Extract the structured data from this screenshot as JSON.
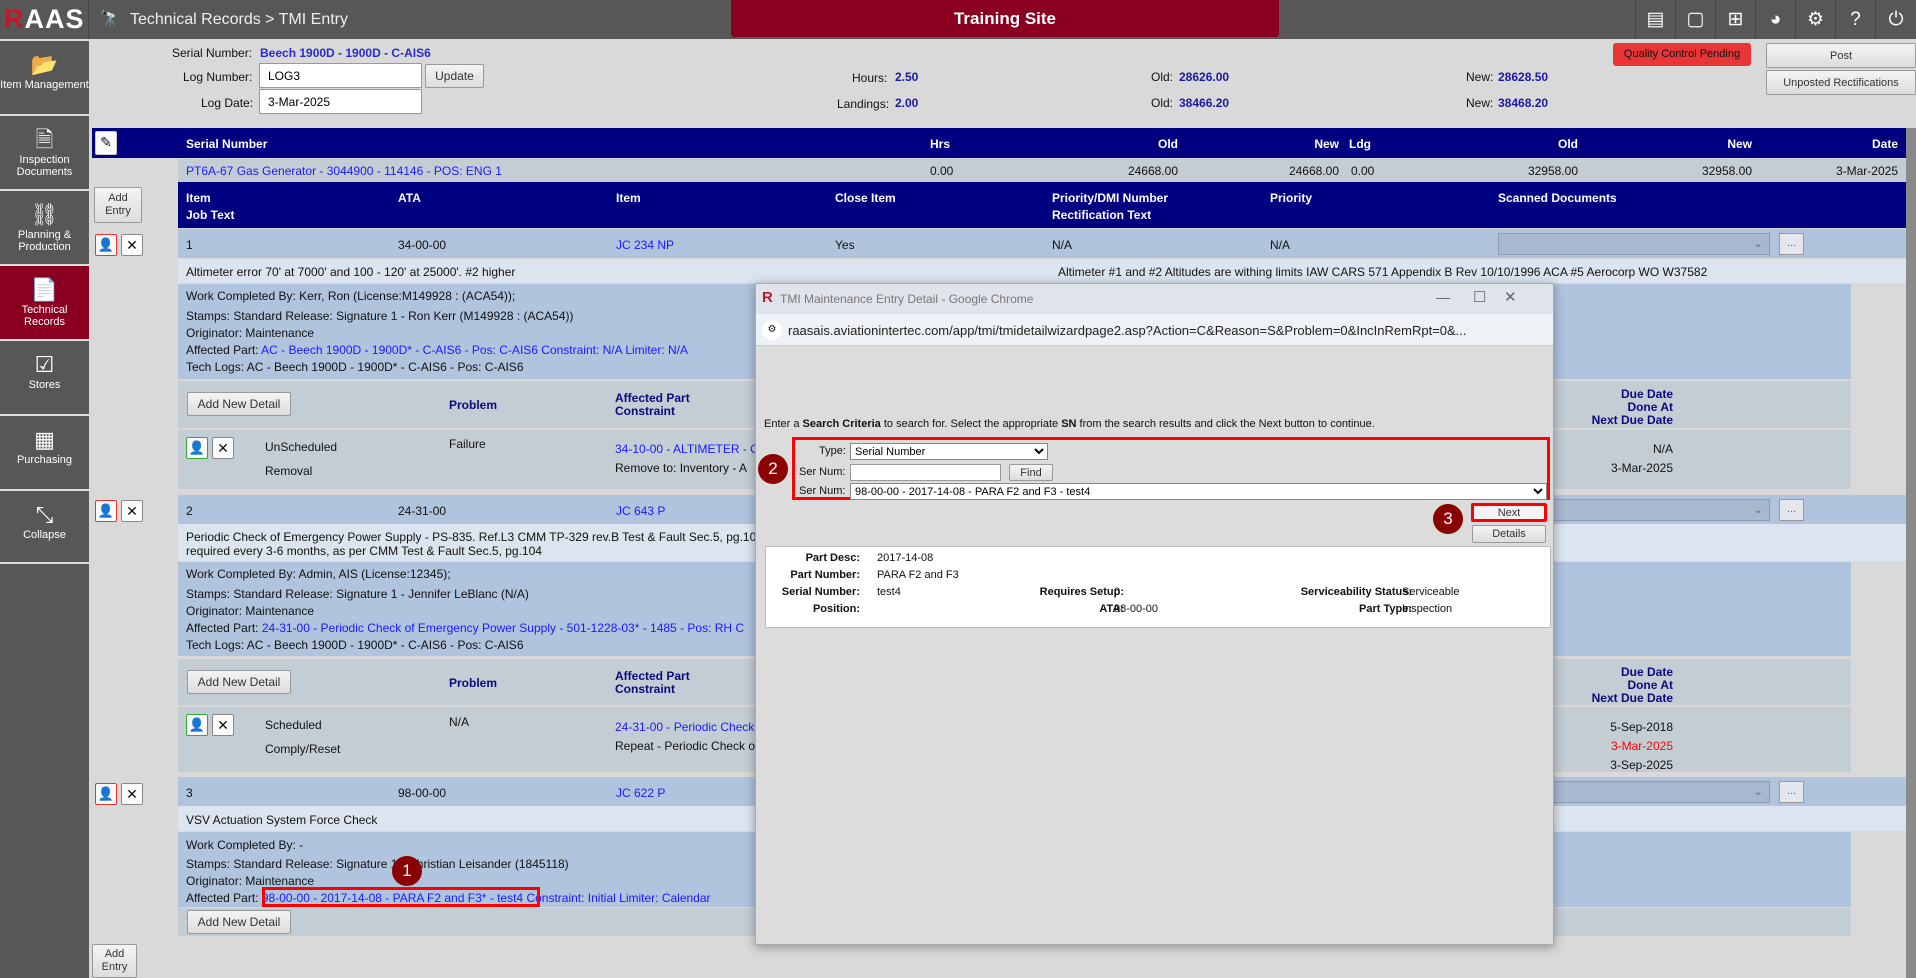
{
  "topbar": {
    "logo": "RAAS",
    "breadcrumb": "Technical Records > TMI Entry",
    "banner": "Training Site",
    "icons": [
      "contact-card-icon",
      "comment-icon",
      "add-box-icon",
      "pie-chart-icon",
      "settings-icon",
      "help-icon",
      "power-icon"
    ]
  },
  "sidebar": {
    "items": [
      {
        "label": "Item Management",
        "icon": "folder-icon"
      },
      {
        "label": "Inspection Documents",
        "icon": "document-icon"
      },
      {
        "label": "Planning & Production",
        "icon": "flow-icon"
      },
      {
        "label": "Technical Records",
        "icon": "record-icon",
        "active": true
      },
      {
        "label": "Stores",
        "icon": "clipboard-check-icon"
      },
      {
        "label": "Purchasing",
        "icon": "calculator-icon"
      },
      {
        "label": "Collapse",
        "icon": "collapse-icon"
      }
    ]
  },
  "header": {
    "serial_label": "Serial Number:",
    "serial_value": "Beech 1900D - 1900D - C-AIS6",
    "log_label": "Log Number:",
    "log_value": "LOG3",
    "update": "Update",
    "date_label": "Log Date:",
    "date_value": "3-Mar-2025",
    "hours_label": "Hours:",
    "hours": "2.50",
    "landings_label": "Landings:",
    "landings": "2.00",
    "old_label": "Old:",
    "new_label": "New:",
    "hours_old": "28626.00",
    "hours_new": "28628.50",
    "land_old": "38466.20",
    "land_new": "38468.20",
    "qc": "Quality Control Pending",
    "post": "Post",
    "unposted": "Unposted Rectifications"
  },
  "component": {
    "headers": [
      "Serial Number",
      "Hrs",
      "Old",
      "New",
      "Ldg",
      "Old",
      "New",
      "Date"
    ],
    "row": [
      "PT6A-67 Gas Generator - 3044900 - 114146 - POS: ENG 1",
      "0.00",
      "24668.00",
      "24668.00",
      "0.00",
      "32958.00",
      "32958.00",
      "3-Mar-2025"
    ]
  },
  "items_header": {
    "add_entry": "Add Entry",
    "item": "Item",
    "job_text": "Job Text",
    "ata": "ATA",
    "item2": "Item",
    "close": "Close Item",
    "dmi": "Priority/DMI Number",
    "rect": "Rectification Text",
    "priority": "Priority",
    "scanned": "Scanned Documents"
  },
  "entries": [
    {
      "num": "1",
      "ata": "34-00-00",
      "jc": "JC 234 NP",
      "close": "Yes",
      "dmi": "N/A",
      "priority": "N/A",
      "job": "Altimeter error 70' at 7000' and 100 - 120' at 25000'. #2 higher",
      "rect": "Altimeter #1 and #2 Altitudes are withing limits IAW CARS 571 Appendix B Rev 10/10/1996 ACA #5 Aerocorp WO W37582",
      "work": "Work Completed By: Kerr, Ron (License:M149928 : (ACA54));",
      "stamps": "Stamps: Standard Release: Signature 1 - Ron Kerr (M149928 : (ACA54))",
      "orig": "Originator: Maintenance",
      "aff_label": "Affected Part:",
      "aff": "AC - Beech 1900D - 1900D* - C-AIS6 - Pos: C-AIS6 Constraint: N/A Limiter: N/A",
      "tech": "Tech Logs: AC - Beech 1900D - 1900D* - C-AIS6 - Pos: C-AIS6",
      "detail": {
        "type": "UnScheduled",
        "action": "Removal",
        "problem": "Failure",
        "part": "34-10-00 - ALTIMETER - C",
        "constraint": "Remove to: Inventory - A",
        "dates": [
          "N/A",
          "3-Mar-2025"
        ]
      }
    },
    {
      "num": "2",
      "ata": "24-31-00",
      "jc": "JC 643 P",
      "job": "Periodic Check of Emergency Power Supply - PS-835. Ref.L3 CMM TP-329 rev.B Test & Fault Sec.5, pg.104",
      "job2": "required every 3-6 months, as per CMM Test & Fault Sec.5, pg.104",
      "work": "Work Completed By: Admin, AIS (License:12345);",
      "stamps": "Stamps: Standard Release: Signature 1 - Jennifer LeBlanc (N/A)",
      "orig": "Originator: Maintenance",
      "aff_label": "Affected Part:",
      "aff": "24-31-00 - Periodic Check of Emergency Power Supply - 501-1228-03* - 1485 - Pos: RH C",
      "tech": "Tech Logs: AC - Beech 1900D - 1900D* - C-AIS6 - Pos: C-AIS6",
      "detail": {
        "type": "Scheduled",
        "action": "Comply/Reset",
        "problem": "N/A",
        "part": "24-31-00 - Periodic Check",
        "constraint": "Repeat - Periodic Check of",
        "dates": [
          "5-Sep-2018",
          "3-Mar-2025",
          "3-Sep-2025"
        ]
      }
    },
    {
      "num": "3",
      "ata": "98-00-00",
      "jc": "JC 622 P",
      "job": "VSV Actuation System Force Check",
      "work": "Work Completed By: -",
      "stamps": "Stamps: Standard Release: Signature 1 - Christian Leisander (1845118)",
      "orig": "Originator: Maintenance",
      "aff_label": "Affected Part:",
      "aff": "98-00-00 - 2017-14-08 - PARA F2 and F3* - test4",
      "aff2": " Constraint: Initial Limiter: Calendar"
    }
  ],
  "detail_header": {
    "add": "Add New Detail",
    "problem": "Problem",
    "aff1": "Affected Part",
    "aff2": "Constraint",
    "due": "Due Date",
    "done": "Done At",
    "next": "Next Due Date"
  },
  "overdue_color": "#ff0000",
  "popup": {
    "title": "TMI Maintenance Entry Detail - Google Chrome",
    "url": "raasais.aviationintertec.com/app/tmi/tmidetailwizardpage2.asp?Action=C&Reason=S&Problem=0&IncInRemRpt=0&...",
    "instr_a": "Enter a ",
    "instr_b": "Search Criteria",
    "instr_c": " to search for. Select the appropriate ",
    "instr_d": "SN",
    "instr_e": " from the search results and click the Next button to continue.",
    "type_label": "Type:",
    "type_value": "Serial Number",
    "sn_label": "Ser Num:",
    "sn_input": "",
    "find": "Find",
    "sn2_label": "Ser Num:",
    "sn_select": "98-00-00 - 2017-14-08 - PARA F2 and F3 - test4",
    "next": "Next",
    "details": "Details",
    "info": {
      "desc_l": "Part Desc:",
      "desc": "2017-14-08",
      "pn_l": "Part Number:",
      "pn": "PARA F2 and F3",
      "sn_l": "Serial Number:",
      "sn": "test4",
      "pos_l": "Position:",
      "pos": "",
      "setup_l": "Requires Setup:",
      "setup": "0",
      "ata_l": "ATA:",
      "ata": "98-00-00",
      "svc_l": "Serviceability Status:",
      "svc": "Serviceable",
      "pt_l": "Part Type:",
      "pt": "Inspection"
    }
  },
  "annotations": [
    "1",
    "2",
    "3"
  ]
}
